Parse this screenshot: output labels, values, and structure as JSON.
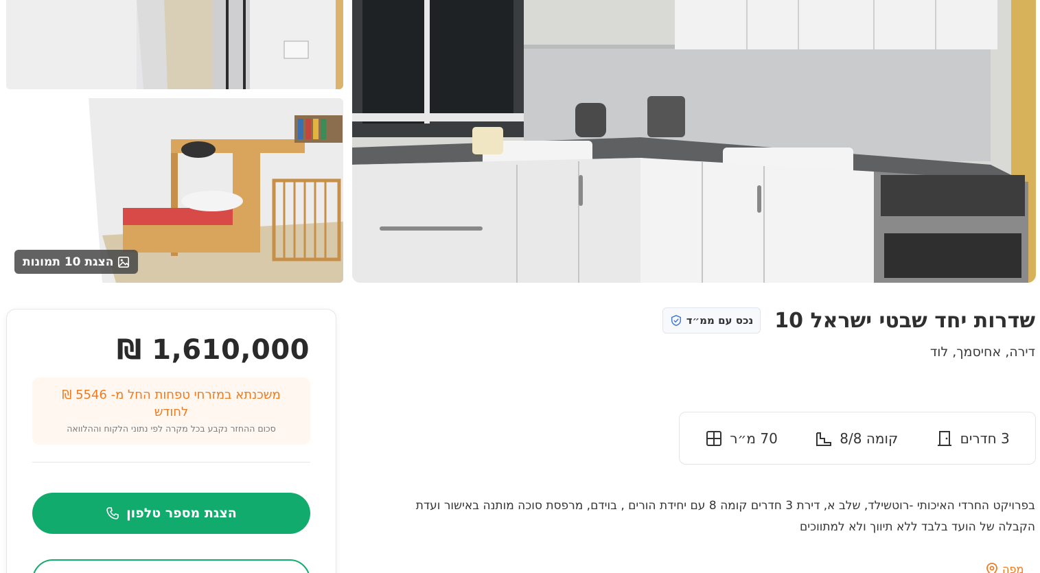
{
  "gallery": {
    "photos_button_label": "הצגת 10 תמונות",
    "photos_icon": "image-icon"
  },
  "listing": {
    "title": "שדרות יחד שבטי ישראל 10",
    "tag_label": "נכס עם ממ״ד",
    "tag_icon": "shield-check-icon",
    "subtitle": "דירה, אחיסמך, לוד",
    "features": {
      "rooms": "3 חדרים",
      "floor": "קומה 8/8",
      "area": "70 מ״ר"
    },
    "description": "בפרויקט החרדי האיכותי -רוטשילד, שלב א, דירת 3 חדרים קומה 8 עם יחידת הורים , בוידם, מרפסת סוכה מותנה באישור ועדת הקבלה של הועד בלבד ללא תיווך ולא למתווכים",
    "map_label": "מפה"
  },
  "price_card": {
    "price": "1,610,000 ₪",
    "mortgage_text": "משכנתא במזרחי טפחות החל מ- 5546 ₪ לחודש",
    "mortgage_note": "סכום ההחזר נקבע בכל מקרה לפי נתוני הלקוח וההלוואה",
    "phone_button_label": "הצגת מספר טלפון"
  },
  "colors": {
    "accent_green": "#12ab6e",
    "accent_orange": "#f07a1d"
  }
}
